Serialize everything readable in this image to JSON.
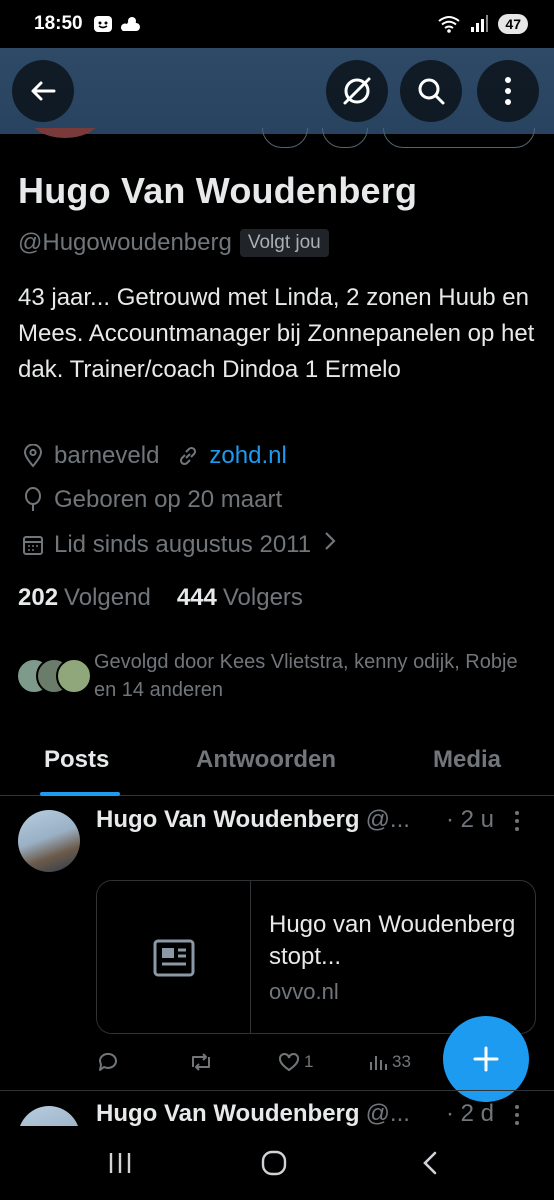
{
  "status_bar": {
    "time": "18:50",
    "battery": "47"
  },
  "header": {
    "back_icon": "arrow-left-icon",
    "actions": [
      "no-translate-icon",
      "search-icon",
      "more-vertical-icon"
    ],
    "banner_color": "#2f4a66"
  },
  "profile": {
    "name": "Hugo Van Woudenberg",
    "handle": "@Hugowoudenberg",
    "follows_you": "Volgt jou",
    "bio": "43 jaar... Getrouwd met Linda, 2 zonen Huub en Mees. Accountmanager bij Zonnepanelen op het dak. Trainer/coach Dindoa 1 Ermelo",
    "location": "barneveld",
    "website": "zohd.nl",
    "birthday": "Geboren op 20 maart",
    "joined": "Lid sinds augustus 2011",
    "following_count": "202",
    "following_label": "Volgend",
    "followers_count": "444",
    "followers_label": "Volgers",
    "followed_by": "Gevolgd door Kees Vlietstra, kenny odijk, Robje en 14 anderen"
  },
  "tabs": [
    {
      "label": "Posts",
      "active": true
    },
    {
      "label": "Antwoorden",
      "active": false
    },
    {
      "label": "Media",
      "active": false
    }
  ],
  "posts": [
    {
      "name": "Hugo Van Woudenberg",
      "handle": "@...",
      "time": "· 2 u",
      "card": {
        "title": "Hugo van Woudenberg stopt...",
        "domain": "ovvo.nl"
      },
      "likes": "1",
      "views": "33"
    },
    {
      "name": "Hugo Van Woudenberg",
      "handle": "@...",
      "time": "· 2 d"
    }
  ],
  "colors": {
    "accent": "#1d9bf0",
    "muted": "#71767b",
    "text": "#e7e9ea"
  }
}
